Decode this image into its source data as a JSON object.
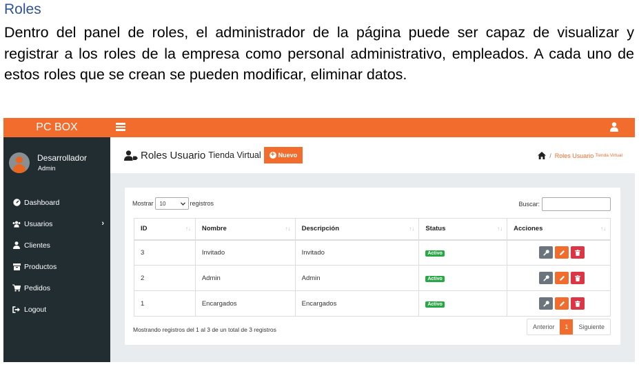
{
  "doc": {
    "heading": "Roles",
    "paragraph": "Dentro del panel de roles, el administrador de la página puede ser capaz de visualizar y registrar a los roles de la empresa como personal administrativo, empleados. A cada uno de estos roles que se crean se pueden modificar, eliminar datos."
  },
  "app": {
    "brand": "PC BOX",
    "accent_color": "#f26d2d",
    "sidebar_color": "#222d32"
  },
  "profile": {
    "name": "Desarrollador",
    "role": "Admin"
  },
  "nav": [
    {
      "label": "Dashboard",
      "icon": "dashboard-icon"
    },
    {
      "label": "Usuarios",
      "icon": "users-icon"
    },
    {
      "label": "Clientes",
      "icon": "user-icon"
    },
    {
      "label": "Productos",
      "icon": "archive-icon"
    },
    {
      "label": "Pedidos",
      "icon": "cart-icon"
    },
    {
      "label": "Logout",
      "icon": "logout-icon"
    }
  ],
  "page": {
    "title": "Roles Usuario",
    "subtitle": "Tienda Virtual",
    "new_button": "Nuevo",
    "breadcrumb_current": "Roles Usuario",
    "breadcrumb_sub": "Tienda Virtual"
  },
  "table_controls": {
    "show_label": "Mostrar",
    "page_size": "10",
    "records_label": "registros",
    "search_label": "Buscar:"
  },
  "table": {
    "columns": [
      "ID",
      "Nombre",
      "Descripción",
      "Status",
      "Acciones"
    ],
    "rows": [
      {
        "id": "3",
        "nombre": "Invitado",
        "descripcion": "Invitado",
        "status": "Activo"
      },
      {
        "id": "2",
        "nombre": "Admin",
        "descripcion": "Admin",
        "status": "Activo"
      },
      {
        "id": "1",
        "nombre": "Encargados",
        "descripcion": "Encargados",
        "status": "Activo"
      }
    ]
  },
  "footer": {
    "info": "Mostrando registros del 1 al 3 de un total de 3 registros",
    "prev": "Anterior",
    "current_page": "1",
    "next": "Siguiente"
  }
}
